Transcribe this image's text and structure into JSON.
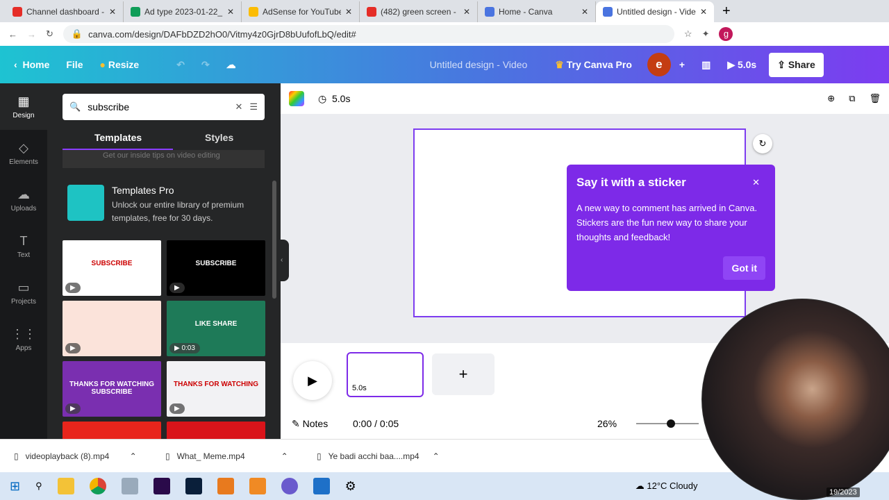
{
  "browser": {
    "tabs": [
      {
        "title": "Channel dashboard -",
        "color": "#e52d27"
      },
      {
        "title": "Ad type 2023-01-22_",
        "color": "#0f9d58"
      },
      {
        "title": "AdSense for YouTube",
        "color": "#fbbc04"
      },
      {
        "title": "(482) green screen -",
        "color": "#e52d27"
      },
      {
        "title": "Home - Canva",
        "color": "#4a74e0"
      },
      {
        "title": "Untitled design - Vide",
        "color": "#4a74e0",
        "active": true
      }
    ],
    "url": "canva.com/design/DAFbDZD2hO0/Vitmy4z0GjrD8bUufofLbQ/edit#"
  },
  "header": {
    "home": "Home",
    "file": "File",
    "resize": "Resize",
    "title": "Untitled design - Video",
    "try_pro": "Try Canva Pro",
    "avatar": "e",
    "duration": "5.0s",
    "share": "Share"
  },
  "rail": [
    {
      "label": "Design",
      "icon": "layout-icon"
    },
    {
      "label": "Elements",
      "icon": "shapes-icon"
    },
    {
      "label": "Uploads",
      "icon": "cloud-upload-icon"
    },
    {
      "label": "Text",
      "icon": "text-icon"
    },
    {
      "label": "Projects",
      "icon": "folder-icon"
    },
    {
      "label": "Apps",
      "icon": "grid-icon"
    }
  ],
  "panel": {
    "search_value": "subscribe",
    "tabs": [
      "Templates",
      "Styles"
    ],
    "clipped_text": "Get our inside tips on video editing",
    "promo_title": "Templates Pro",
    "promo_text": "Unlock our entire library of premium templates, free for 30 days.",
    "thumbs": [
      {
        "bg": "#ffffff",
        "text": "SUBSCRIBE"
      },
      {
        "bg": "#000000",
        "text": "SUBSCRIBE"
      },
      {
        "bg": "#fbe3da",
        "text": ""
      },
      {
        "bg": "#1e7a58",
        "text": "LIKE SHARE",
        "duration": "0:03"
      },
      {
        "bg": "#7a2fb0",
        "text": "THANKS FOR WATCHING SUBSCRIBE"
      },
      {
        "bg": "#f2f2f4",
        "text": "THANKS FOR WATCHING"
      },
      {
        "bg": "#e8251c",
        "text": ""
      },
      {
        "bg": "#d9141a",
        "text": ""
      }
    ]
  },
  "canvas": {
    "duration": "5.0s"
  },
  "popup": {
    "title": "Say it with a sticker",
    "body": "A new way to comment has arrived in Canva. Stickers are the fun new way to share your thoughts and feedback!",
    "button": "Got it"
  },
  "timeline": {
    "clip_duration": "5.0s",
    "notes": "Notes",
    "time": "0:00 / 0:05",
    "zoom": "26%",
    "zoom_value": 0.26
  },
  "downloads": [
    "videoplayback (8).mp4",
    "What_ Meme.mp4",
    "Ye badi acchi baa....mp4"
  ],
  "taskbar": {
    "weather": "12°C  Cloudy",
    "date": "19/2023"
  },
  "colors": {
    "accent": "#7d2ae8",
    "header_start": "#1ec3d2",
    "header_end": "#7c3cf0"
  }
}
